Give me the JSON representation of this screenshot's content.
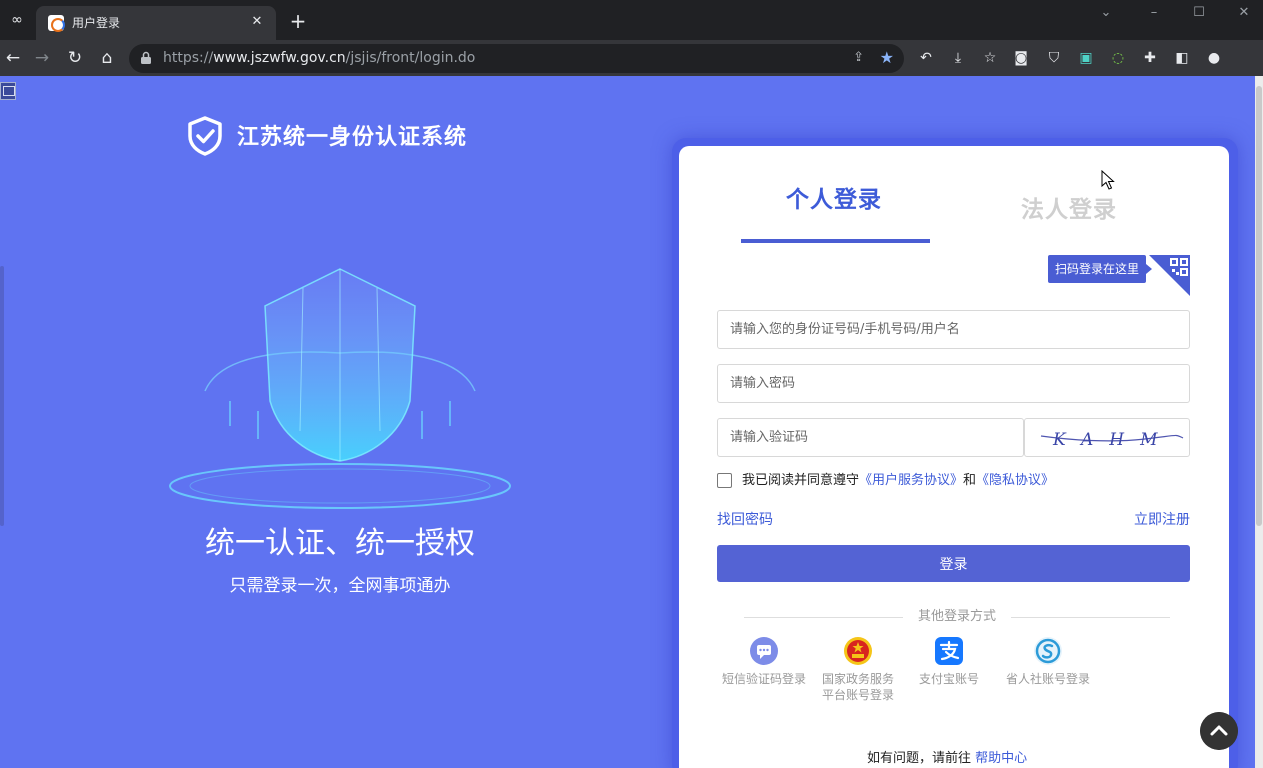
{
  "browser": {
    "tab_title": "用户登录",
    "tab_close": "✕",
    "new_tab": "+",
    "url_prefix": "https://",
    "url_domain": "www.jszwfw.gov.cn",
    "url_path": "/jsjis/front/login.do",
    "win_minimize": "–",
    "win_restore": "☐",
    "win_close": "✕",
    "win_menu": "⌄"
  },
  "brand": {
    "title": "江苏统一身份认证系统"
  },
  "hero": {
    "slogan": "统一认证、统一授权",
    "sub_slogan": "只需登录一次，全网事项通办"
  },
  "login": {
    "tab_personal": "个人登录",
    "tab_legal": "法人登录",
    "qr_tip": "扫码登录在这里",
    "username_placeholder": "请输入您的身份证号码/手机号码/用户名",
    "password_placeholder": "请输入密码",
    "captcha_placeholder": "请输入验证码",
    "captcha_text": "KAHM",
    "agree_prefix": "我已阅读并同意遵守",
    "agree_link_1": "《用户服务协议》",
    "agree_and": "和",
    "agree_link_2": "《隐私协议》",
    "forgot": "找回密码",
    "register": "立即注册",
    "submit": "登录",
    "other_title": "其他登录方式",
    "other_methods": [
      {
        "icon": "sms-icon",
        "label": "短信验证码登录",
        "label2": ""
      },
      {
        "icon": "national-emblem-icon",
        "label": "国家政务服务",
        "label2": "平台账号登录"
      },
      {
        "icon": "alipay-icon",
        "label": "支付宝账号",
        "label2": ""
      },
      {
        "icon": "social-security-icon",
        "label": "省人社账号登录",
        "label2": ""
      }
    ],
    "help_prefix": "如有问题，请前往",
    "help_link": "帮助中心"
  },
  "colors": {
    "page_bg": "#5f73f1",
    "accent": "#3d5bd8",
    "button": "#5463d4"
  }
}
